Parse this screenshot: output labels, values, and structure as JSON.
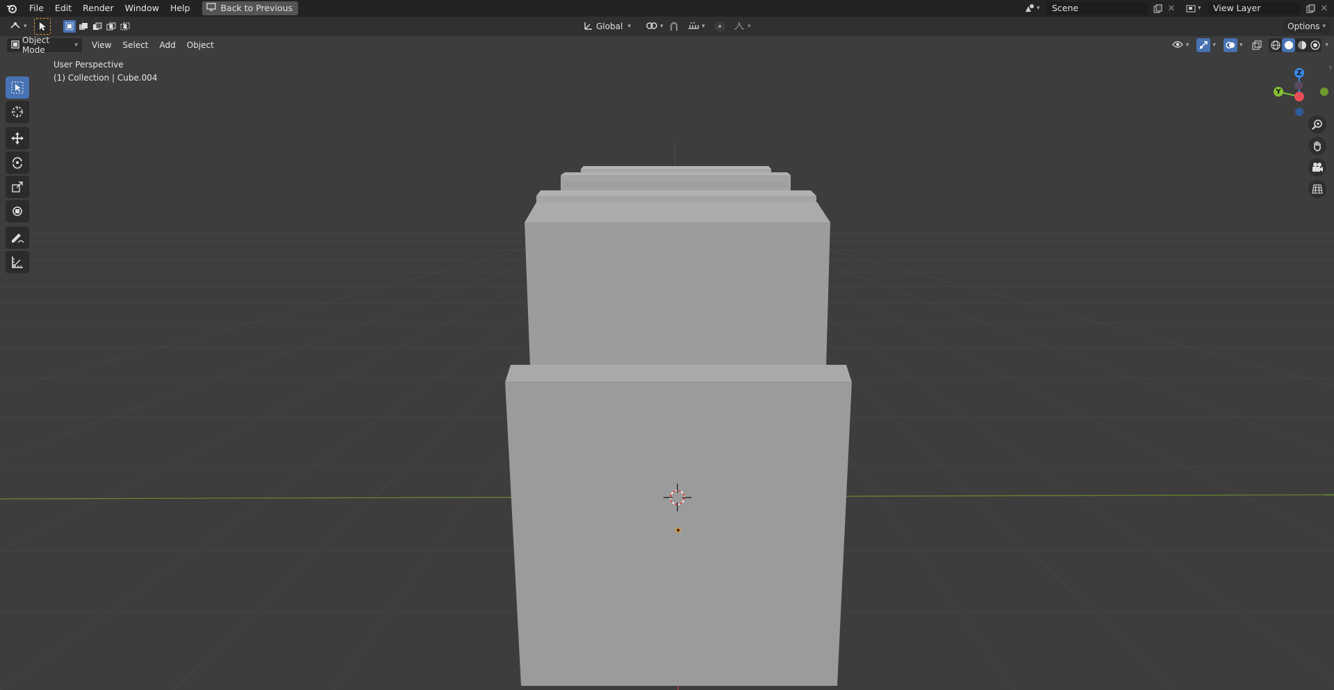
{
  "app": {
    "name": "Blender"
  },
  "menubar": {
    "items": [
      "File",
      "Edit",
      "Render",
      "Window",
      "Help"
    ],
    "back_button": "Back to Previous"
  },
  "scene": {
    "name": "Scene"
  },
  "view_layer": {
    "name": "View Layer"
  },
  "toolbar": {
    "transform_orientation": "Global",
    "options_label": "Options"
  },
  "viewport_header": {
    "mode": "Object Mode",
    "menus": [
      "View",
      "Select",
      "Add",
      "Object"
    ]
  },
  "viewport": {
    "view_name": "User Perspective",
    "context": "(1) Collection | Cube.004",
    "gizmo_axes": {
      "z": "Z",
      "y": "Y"
    }
  },
  "colors": {
    "background": "#3d3d3d",
    "active_tool": "#4772b3",
    "x_axis": "#e84e5a",
    "y_axis": "#84c132",
    "z_axis": "#3a89ea",
    "cube": "#9a9c9b"
  },
  "tools": [
    "select-box-icon",
    "cursor-icon",
    "move-icon",
    "rotate-icon",
    "scale-icon",
    "transform-icon",
    "annotate-icon",
    "measure-icon"
  ]
}
